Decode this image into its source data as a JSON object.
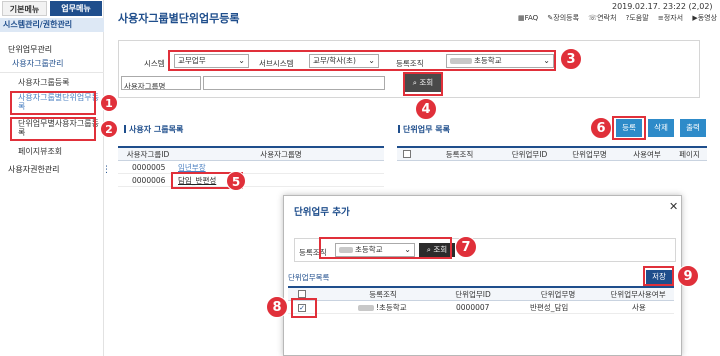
{
  "sidebar": {
    "tab_basic": "기본메뉴",
    "tab_work": "업무메뉴",
    "section": "시스템관리/권한관리",
    "items": [
      {
        "label": "단위업무관리"
      },
      {
        "label": "사용자그룹관리"
      },
      {
        "label": "사용자그룹등록"
      },
      {
        "label": "사용자그룹별단위업무등록"
      },
      {
        "label": "단위업무별사용자그룹등록"
      },
      {
        "label": "페이지뷰조회"
      },
      {
        "label": "사용자권한관리"
      }
    ]
  },
  "header": {
    "title": "사용자그룹별단위업무등록",
    "datetime": "2019.02.17. 23:22 (2,02)",
    "links": [
      "FAQ",
      "장의등록",
      "연락처",
      "도움말",
      "정자서",
      "동영상"
    ]
  },
  "search": {
    "system_label": "시스템",
    "system_value": "교무업무",
    "subsystem_label": "서브시스템",
    "subsystem_value": "교무/학사(초)",
    "org_label": "등록조직",
    "org_value": "초등학교",
    "group_name_label": "사용자그룹명",
    "group_name_value": "",
    "search_button": "조회"
  },
  "left_table": {
    "title": "사용자 그룹목록",
    "columns": [
      "사용자그룹ID",
      "사용자그룹명"
    ],
    "rows": [
      {
        "id": "0000005",
        "name": "임년부장"
      },
      {
        "id": "0000006",
        "name": "담임_반편성"
      }
    ]
  },
  "right_table": {
    "title": "단위업무 목록",
    "buttons": [
      "등록",
      "삭제",
      "출력"
    ],
    "columns": [
      "등록조직",
      "단위업무ID",
      "단위업무명",
      "사용여부",
      "페이지"
    ]
  },
  "modal": {
    "title": "단위업무 추가",
    "org_label": "등록조직",
    "org_value": "초등학교",
    "search_button": "조회",
    "list_title": "단위업무목록",
    "save_button": "저장",
    "columns": [
      "등록조직",
      "단위업무ID",
      "단위업무명",
      "단위업무사용여부"
    ],
    "rows": [
      {
        "org": "!초등학교",
        "id": "0000007",
        "name": "반편성_담임",
        "use": "사용"
      }
    ]
  },
  "callouts": [
    "1",
    "2",
    "3",
    "4",
    "5",
    "6",
    "7",
    "8",
    "9"
  ],
  "colors": {
    "accent": "#1f4e8c",
    "callout": "#e0303a",
    "button_blue": "#2e8bc9"
  }
}
